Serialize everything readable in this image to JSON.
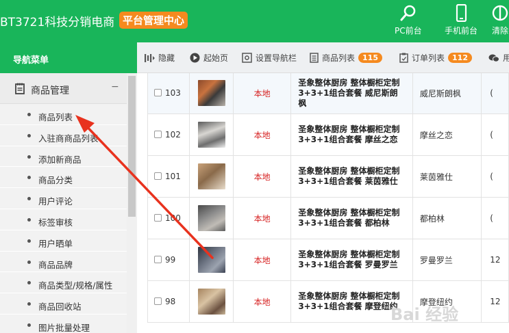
{
  "header": {
    "brand": "BT3721科技分销电商",
    "badge": "平台管理中心",
    "buttons": [
      {
        "label": "PC前台",
        "icon": "search-icon"
      },
      {
        "label": "手机前台",
        "icon": "mobile-icon"
      },
      {
        "label": "清除",
        "icon": "clear-icon"
      }
    ],
    "color": "#19b55a",
    "accent": "#f58a1f"
  },
  "sidebar": {
    "title": "导航菜单",
    "group": {
      "label": "商品管理",
      "toggle": "−",
      "icon": "notepad-icon"
    },
    "items": [
      {
        "label": "商品列表"
      },
      {
        "label": "入驻商商品列表"
      },
      {
        "label": "添加新商品"
      },
      {
        "label": "商品分类"
      },
      {
        "label": "用户评论"
      },
      {
        "label": "标签审核"
      },
      {
        "label": "用户晒单"
      },
      {
        "label": "商品品牌"
      },
      {
        "label": "商品类型/规格/属性"
      },
      {
        "label": "商品回收站"
      },
      {
        "label": "图片批量处理"
      }
    ]
  },
  "toolbar": {
    "items": [
      {
        "label": "隐藏",
        "icon": "collapse-icon"
      },
      {
        "label": "起始页",
        "icon": "play-icon"
      },
      {
        "label": "设置导航栏",
        "icon": "settings-icon"
      },
      {
        "label": "商品列表",
        "icon": "list-icon",
        "badge": "115"
      },
      {
        "label": "订单列表",
        "icon": "order-icon",
        "badge": "112"
      },
      {
        "label": "用",
        "icon": "chat-icon"
      }
    ]
  },
  "table": {
    "rows": [
      {
        "id": "103",
        "source": "本地",
        "name": "圣象整体厨房 整体橱柜定制3+3+1组合套餐 威尼斯朗枫",
        "brand": "威尼斯朗枫",
        "extra": "("
      },
      {
        "id": "102",
        "source": "本地",
        "name": "圣象整体厨房 整体橱柜定制3+3+1组合套餐 摩丝之恋",
        "brand": "摩丝之恋",
        "extra": "("
      },
      {
        "id": "101",
        "source": "本地",
        "name": "圣象整体厨房 整体橱柜定制3+3+1组合套餐 莱茵雅仕",
        "brand": "莱茵雅仕",
        "extra": "("
      },
      {
        "id": "100",
        "source": "本地",
        "name": "圣象整体厨房 整体橱柜定制3+3+1组合套餐 都柏林",
        "brand": "都柏林",
        "extra": "("
      },
      {
        "id": "99",
        "source": "本地",
        "name": "圣象整体厨房 整体橱柜定制3+3+1组合套餐 罗曼罗兰",
        "brand": "罗曼罗兰",
        "extra": "12"
      },
      {
        "id": "98",
        "source": "本地",
        "name": "圣象整体厨房 整体橱柜定制3+3+1组合套餐 摩登纽约",
        "brand": "摩登纽约",
        "extra": "12"
      }
    ]
  },
  "watermark": "Bai 经验"
}
